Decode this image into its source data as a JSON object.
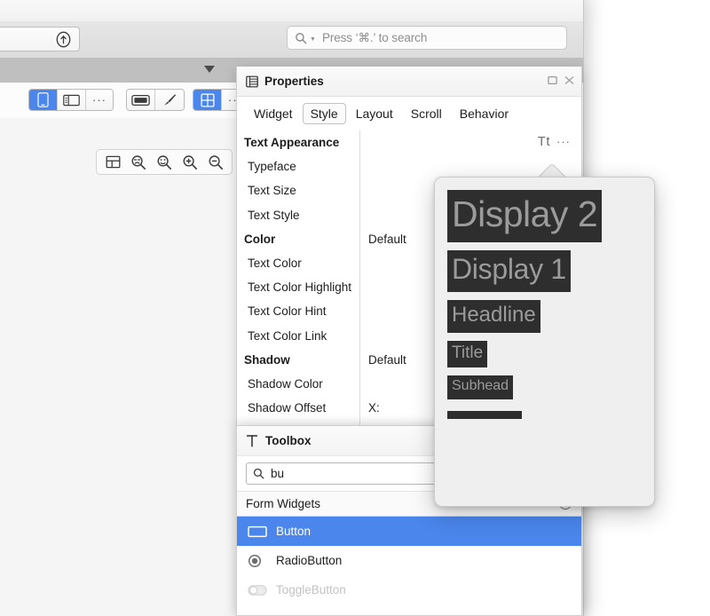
{
  "app": {
    "ide_window_name": "android-studio-layout-editor"
  },
  "toolbar": {
    "upload_icon": "upload-circle-icon",
    "search": {
      "icon": "search-icon",
      "dropdown_icon": "chevron-down-icon",
      "placeholder": "Press ‘⌘.’ to search",
      "value": ""
    },
    "overflow_caret_icon": "caret-down-icon"
  },
  "editor_toolbar": {
    "groups": [
      {
        "name": "device-mode-group",
        "cells": [
          {
            "icon": "phone-icon",
            "active": true
          },
          {
            "icon": "tablet-landscape-icon",
            "active": false
          },
          {
            "icon": "more-options-icon",
            "label": "···",
            "active": false
          }
        ]
      },
      {
        "name": "theme-group",
        "cells": [
          {
            "icon": "night-mode-icon",
            "active": false
          },
          {
            "icon": "theme-brush-icon",
            "active": false
          }
        ]
      },
      {
        "name": "layout-view-group",
        "cells": [
          {
            "icon": "grid-layout-icon",
            "active": true
          },
          {
            "icon": "more-options-icon",
            "label": "···",
            "active": false
          }
        ]
      }
    ]
  },
  "canvas": {
    "zoom_controls": [
      {
        "icon": "fit-to-screen-icon"
      },
      {
        "icon": "zoom-out-magnifier-icon"
      },
      {
        "icon": "zoom-reset-magnifier-icon"
      },
      {
        "icon": "zoom-in-icon"
      },
      {
        "icon": "zoom-out-icon"
      }
    ]
  },
  "properties": {
    "title": "Properties",
    "header_icon": "properties-list-icon",
    "window_buttons": [
      {
        "name": "maximize-button",
        "icon": "maximize-icon"
      },
      {
        "name": "close-button",
        "icon": "close-icon"
      }
    ],
    "tabs": [
      {
        "label": "Widget",
        "selected": false
      },
      {
        "label": "Style",
        "selected": true
      },
      {
        "label": "Layout",
        "selected": false
      },
      {
        "label": "Scroll",
        "selected": false
      },
      {
        "label": "Behavior",
        "selected": false
      }
    ],
    "text_style_control": {
      "label": "Tt",
      "more_label": "···"
    },
    "rows": [
      {
        "name": "Text Appearance",
        "value": "",
        "group": true
      },
      {
        "name": "Typeface",
        "value": "",
        "group": false
      },
      {
        "name": "Text Size",
        "value": "",
        "group": false
      },
      {
        "name": "Text Style",
        "value": "",
        "group": false
      },
      {
        "name": "Color",
        "value": "Default",
        "group": true
      },
      {
        "name": "Text Color",
        "value": "",
        "group": false
      },
      {
        "name": "Text Color Highlight",
        "value": "",
        "group": false
      },
      {
        "name": "Text Color Hint",
        "value": "",
        "group": false
      },
      {
        "name": "Text Color Link",
        "value": "",
        "group": false
      },
      {
        "name": "Shadow",
        "value": "Default",
        "group": true
      },
      {
        "name": "Shadow Color",
        "value": "",
        "group": false
      },
      {
        "name": "Shadow Offset",
        "value": "X:",
        "group": false
      }
    ]
  },
  "text_style_popover": {
    "items": [
      {
        "label": "Display 2",
        "size_class": "sw-d2"
      },
      {
        "label": "Display 1",
        "size_class": "sw-d1"
      },
      {
        "label": "Headline",
        "size_class": "sw-hl"
      },
      {
        "label": "Title",
        "size_class": "sw-ti"
      },
      {
        "label": "Subhead",
        "size_class": "sw-sh"
      }
    ],
    "swatch_bg": "#2e2e2e",
    "swatch_fg": "#9b9b9b",
    "panel_bg": "#efefef"
  },
  "toolbox": {
    "title": "Toolbox",
    "header_icon": "hammer-icon",
    "search": {
      "icon": "search-icon",
      "value": "bu",
      "placeholder": ""
    },
    "sections": [
      {
        "label": "Form Widgets",
        "collapse_icon": "chevron-up-circle-icon",
        "items": [
          {
            "label": "Button",
            "icon": "button-widget-icon",
            "selected": true,
            "dim": false
          },
          {
            "label": "RadioButton",
            "icon": "radio-button-widget-icon",
            "selected": false,
            "dim": false
          },
          {
            "label": "ToggleButton",
            "icon": "toggle-button-widget-icon",
            "selected": false,
            "dim": true
          }
        ]
      }
    ]
  },
  "colors": {
    "accent_blue": "#4a86ec",
    "canvas_bg": "#f5f5f5",
    "subbar_gray": "#bfbfbf",
    "panel_bg": "#ffffff"
  }
}
